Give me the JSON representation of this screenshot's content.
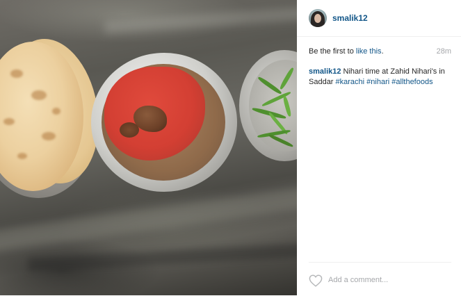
{
  "post": {
    "username": "smalik12",
    "likes_prefix": "Be the first to ",
    "likes_link": "like this",
    "likes_suffix": ".",
    "timestamp": "28m",
    "caption": {
      "username": "smalik12",
      "text": " Nihari time at Zahid Nihari's in Saddar ",
      "hashtags": [
        "#karachi",
        "#nihari",
        "#allthefoods"
      ]
    },
    "comment_placeholder": "Add a comment..."
  },
  "icons": {
    "like": "heart-icon",
    "avatar": "profile-avatar"
  },
  "colors": {
    "link": "#125688",
    "muted": "#a5a7aa",
    "text": "#262626"
  }
}
